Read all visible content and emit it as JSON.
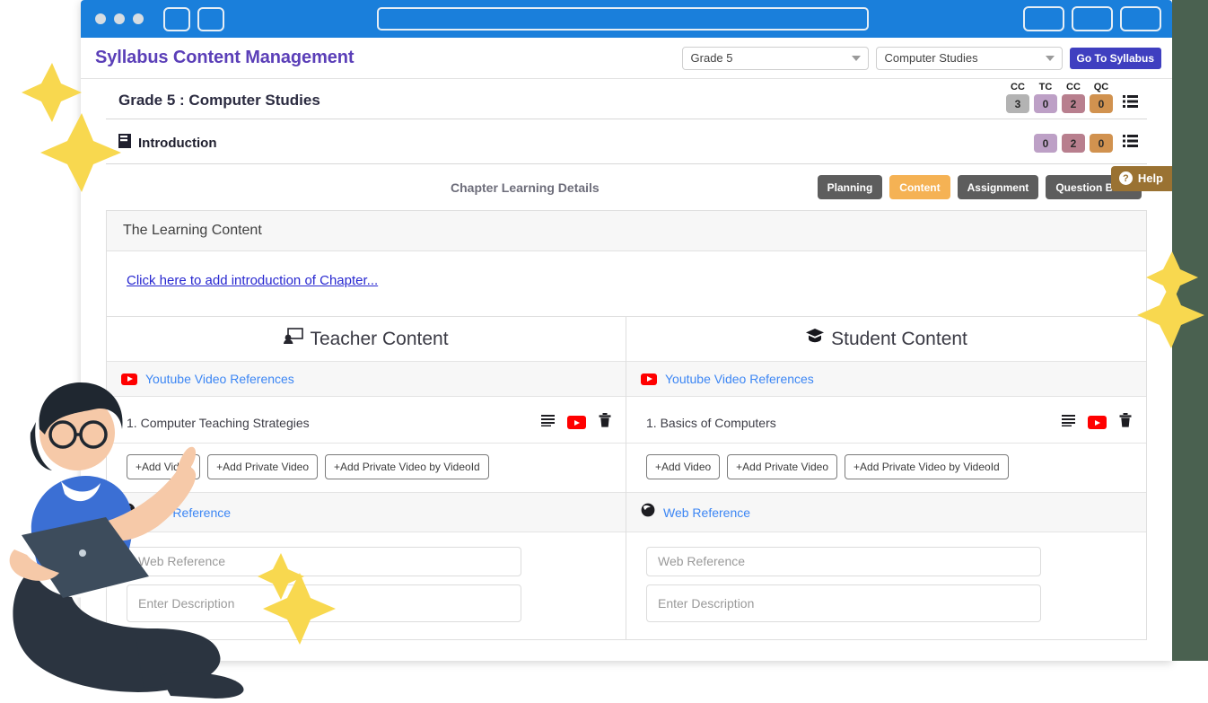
{
  "browser": {
    "dots": 3,
    "left_tabs": 2,
    "right_tabs": 3
  },
  "header": {
    "title": "Syllabus Content Management",
    "grade_select": {
      "value": "Grade 5"
    },
    "subject_select": {
      "value": "Computer Studies"
    },
    "go_to_syllabus": "Go To Syllabus"
  },
  "title_row": {
    "heading": "Grade 5 : Computer Studies",
    "badges": [
      {
        "caption": "CC",
        "value": "3",
        "color": "#b3b3b3"
      },
      {
        "caption": "TC",
        "value": "0",
        "color": "#bda0c6"
      },
      {
        "caption": "CC",
        "value": "2",
        "color": "#b87f8e"
      },
      {
        "caption": "QC",
        "value": "0",
        "color": "#d1924f"
      }
    ]
  },
  "chapter_row": {
    "name": "Introduction",
    "badges": [
      {
        "value": "0",
        "color": "#bda0c6"
      },
      {
        "value": "2",
        "color": "#b87f8e"
      },
      {
        "value": "0",
        "color": "#d1924f"
      }
    ]
  },
  "subhead": {
    "label": "Chapter Learning Details",
    "tabs": [
      {
        "label": "Planning",
        "active": false
      },
      {
        "label": "Content",
        "active": true
      },
      {
        "label": "Assignment",
        "active": false
      },
      {
        "label": "Question Bank",
        "active": false
      }
    ],
    "active_color": "#f5b254",
    "inactive_color": "#5d5d5d"
  },
  "learning_content": {
    "card_title": "The Learning Content",
    "add_intro_link": "Click here to add introduction of Chapter..."
  },
  "teacher": {
    "column_title": "Teacher Content",
    "youtube_section_label": "Youtube Video References",
    "videos": [
      {
        "index": "1.",
        "name": "Computer Teaching Strategies"
      }
    ],
    "buttons": [
      "+Add Video",
      "+Add Private Video",
      "+Add Private Video by VideoId"
    ],
    "web_section_label": "Web Reference",
    "web_reference_placeholder": "Web Reference",
    "description_placeholder": "Enter Description"
  },
  "student": {
    "column_title": "Student Content",
    "youtube_section_label": "Youtube Video References",
    "videos": [
      {
        "index": "1.",
        "name": "Basics of Computers"
      }
    ],
    "buttons": [
      "+Add Video",
      "+Add Private Video",
      "+Add Private Video by VideoId"
    ],
    "web_section_label": "Web Reference",
    "web_reference_placeholder": "Web Reference",
    "description_placeholder": "Enter Description"
  },
  "help": {
    "label": "Help",
    "icon": "question-mark",
    "color": "#9a7232"
  }
}
